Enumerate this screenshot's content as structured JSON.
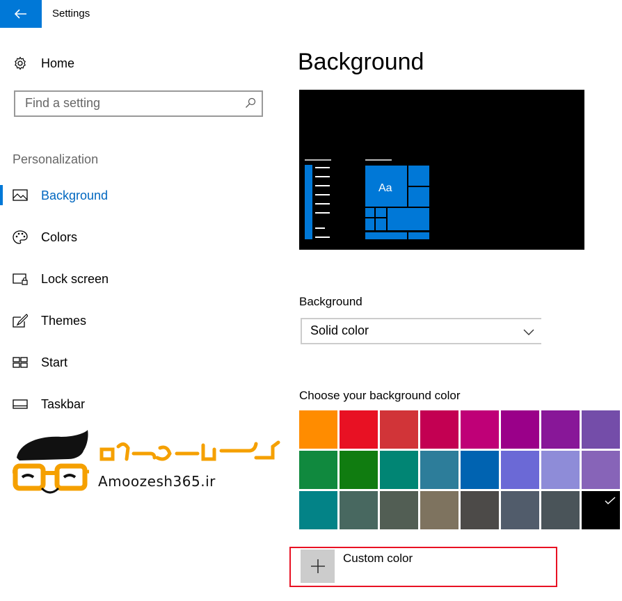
{
  "window": {
    "title": "Settings"
  },
  "sidebar": {
    "home_label": "Home",
    "search_placeholder": "Find a setting",
    "group_label": "Personalization",
    "items": [
      {
        "label": "Background",
        "icon": "picture-icon",
        "active": true
      },
      {
        "label": "Colors",
        "icon": "palette-icon",
        "active": false
      },
      {
        "label": "Lock screen",
        "icon": "lock-screen-icon",
        "active": false
      },
      {
        "label": "Themes",
        "icon": "themes-brush-icon",
        "active": false
      },
      {
        "label": "Start",
        "icon": "start-layout-icon",
        "active": false
      },
      {
        "label": "Taskbar",
        "icon": "taskbar-icon",
        "active": false
      }
    ]
  },
  "main": {
    "title": "Background",
    "preview": {
      "sample_text": "Aa",
      "accent": "#0078d7",
      "background": "#000000"
    },
    "background_setting": {
      "label": "Background",
      "selected": "Solid color"
    },
    "color_section": {
      "label": "Choose your background color",
      "selected_index": 23,
      "colors": [
        "#ff8c00",
        "#e81123",
        "#d13438",
        "#c30052",
        "#bf0077",
        "#9a0089",
        "#881798",
        "#744da9",
        "#10893e",
        "#107c10",
        "#018574",
        "#2d7d9a",
        "#0063b1",
        "#6b69d6",
        "#8e8cd8",
        "#8764b8",
        "#038387",
        "#486860",
        "#525e54",
        "#7e735f",
        "#4c4a48",
        "#515c6b",
        "#4a5459",
        "#000000"
      ]
    },
    "custom_color_label": "Custom color"
  },
  "watermark": {
    "site": "Amoozesh365.ir",
    "logo_lettering": "آموزش ۳۶۵"
  },
  "colors": {
    "accent": "#0078d7",
    "highlight": "#e81123",
    "watermark_orange": "#f5a000"
  }
}
